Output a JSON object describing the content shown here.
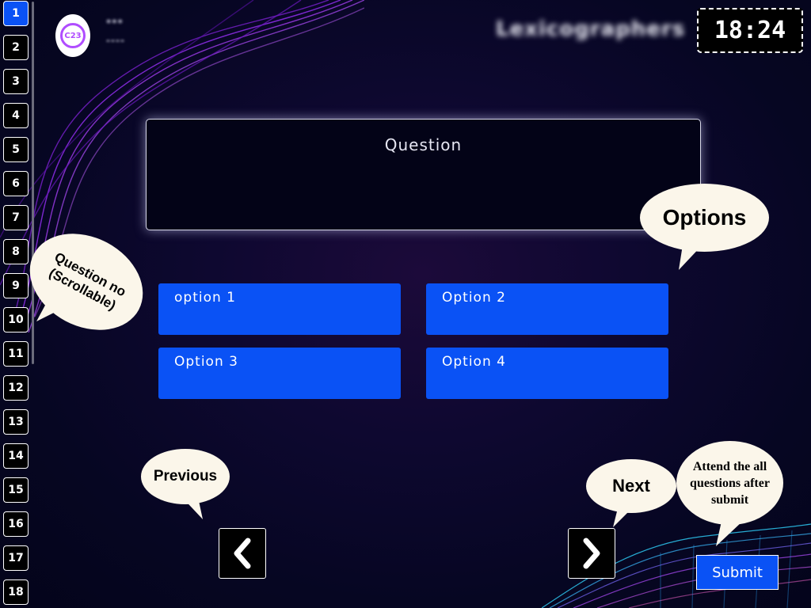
{
  "header": {
    "logo_text": "C23",
    "user_line1": "***",
    "user_line2": "----",
    "team_name": "Lexicographers",
    "timer": "18:24"
  },
  "question_nav": {
    "active": "1",
    "items": [
      "1",
      "2",
      "3",
      "4",
      "5",
      "6",
      "7",
      "8",
      "9",
      "10",
      "11",
      "12",
      "13",
      "14",
      "15",
      "16",
      "17",
      "18"
    ]
  },
  "question": {
    "text": "Question",
    "options": [
      "option 1",
      "Option 2",
      "Option 3",
      "Option 4"
    ]
  },
  "callouts": {
    "question_no": "Question no (Scrollable)",
    "options": "Options",
    "previous": "Previous",
    "next": "Next",
    "submit_hint": "Attend the all questions after submit"
  },
  "controls": {
    "previous_icon": "chevron-left-icon",
    "next_icon": "chevron-right-icon",
    "submit_label": "Submit"
  },
  "colors": {
    "accent": "#0a52f5",
    "background": "#060622",
    "callout": "#fbf6ea",
    "logo_ring": "#b04dff"
  }
}
